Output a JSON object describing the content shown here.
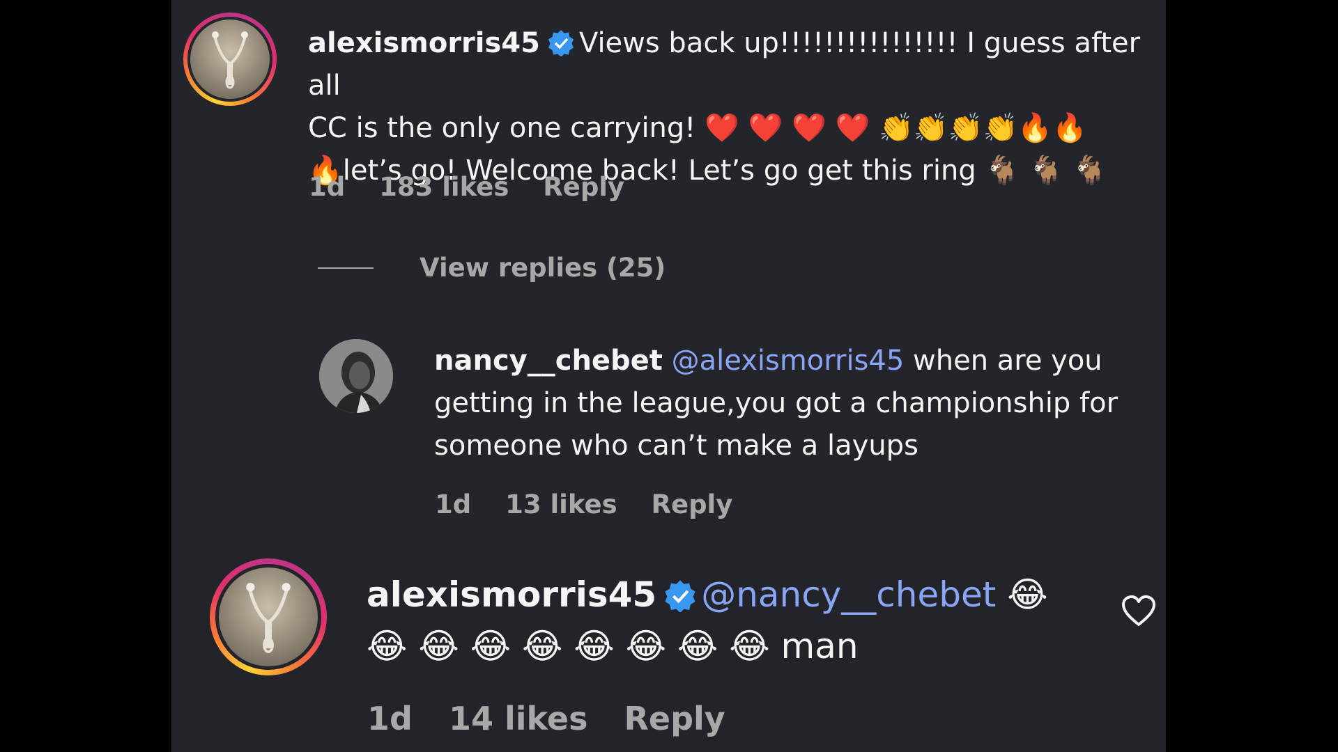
{
  "comment1": {
    "username": "alexismorris45",
    "text_line1": "Views back up!!!!!!!!!!!!!!!! I guess after all",
    "text_line2": "CC is the only one carrying! ❤️ ❤️ ❤️ ❤️ 👏👏👏👏🔥🔥",
    "text_line3": "🔥let’s go! Welcome back! Let’s go get this ring 🐐 🐐 🐐",
    "time": "1d",
    "likes": "183 likes",
    "reply_label": "Reply"
  },
  "view_replies_label": "View replies (25)",
  "reply1": {
    "username": "nancy__chebet",
    "mention": "@alexismorris45",
    "text_line1_rest": "when are you",
    "text_line2": "getting in the league,you got a championship for",
    "text_line3": "someone who can’t make a layups",
    "time": "1d",
    "likes": "13 likes",
    "reply_label": "Reply"
  },
  "reply2": {
    "username": "alexismorris45",
    "mention": "@nancy__chebet",
    "emoji_line1": "😂",
    "emoji_line2": "😂 😂 😂 😂 😂 😂 😂 😂",
    "text_word": "man",
    "time": "1d",
    "likes": "14 likes",
    "reply_label": "Reply"
  },
  "colors": {
    "background": "#24252a",
    "text": "#f5f5f5",
    "muted": "#a8a8a8",
    "mention": "#8aa5f5",
    "verified": "#3897f0"
  },
  "icons": [
    "verified-badge-icon",
    "heart-like-icon"
  ]
}
